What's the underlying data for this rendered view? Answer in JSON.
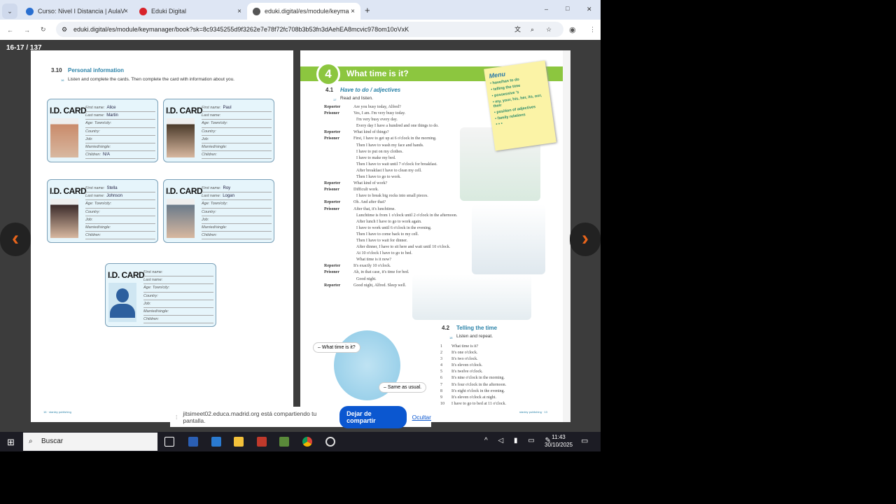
{
  "browser": {
    "tabs": [
      {
        "label": "Curso: Nivel I Distancia | AulaV",
        "close": "×"
      },
      {
        "label": "Eduki Digital",
        "close": "×"
      },
      {
        "label": "eduki.digital/es/module/keyma",
        "close": "×"
      }
    ],
    "new_tab": "+",
    "url": "eduki.digital/es/module/keymanager/book?sk=8c9345255d9f3262e7e78f72fc708b3b53fn3dAehEA8mcvic978om10oVxK",
    "controls": {
      "minimize": "–",
      "maximize": "□",
      "close": "✕"
    }
  },
  "viewer": {
    "page_count": "16-17 / 137",
    "prev": "‹",
    "next": "›"
  },
  "left_page": {
    "section_num": "3.10",
    "section_title": "Personal information",
    "track": "16",
    "instruction": "Listen and complete the cards. Then complete the card with information about you.",
    "card_title": "I.D. CARD",
    "field_labels": [
      "First name:",
      "Last name:",
      "Age:     Town/city:",
      "Country:",
      "Job:",
      "Married/single:",
      "Children:"
    ],
    "cards": [
      {
        "values": [
          "Alice",
          "Martin",
          "",
          "",
          "",
          "",
          "N/A"
        ]
      },
      {
        "values": [
          "Paul",
          "",
          "",
          "",
          "",
          "",
          ""
        ]
      },
      {
        "values": [
          "Stella",
          "Johnson",
          "",
          "",
          "",
          "",
          ""
        ]
      },
      {
        "values": [
          "Roy",
          "Logan",
          "",
          "",
          "",
          "",
          ""
        ]
      },
      {
        "values": [
          "",
          "",
          "",
          "",
          "",
          "",
          ""
        ]
      }
    ],
    "footer": "16 · stanley publishing"
  },
  "right_page": {
    "unit_num": "4",
    "unit_title": "What time is it?",
    "s1_num": "4.1",
    "s1_title": "Have to do / adjectives",
    "s1_track": "17",
    "s1_instr": "Read and listen.",
    "menu": {
      "title": "Menu",
      "items": [
        "• have/has to do",
        "• telling the time",
        "• possessive 's",
        "• my, your, his, her, its, our, their",
        "• position of adjectives",
        "• family relations",
        "* * *"
      ]
    },
    "dialogue": [
      {
        "s": "Reporter",
        "t": "Are you busy today, Alfred?"
      },
      {
        "s": "Prisoner",
        "t": "Yes, I am. I'm very busy today."
      },
      {
        "s": "",
        "t": "I'm very busy every day."
      },
      {
        "s": "",
        "t": "Every day I have a hundred and one things to do."
      },
      {
        "s": "Reporter",
        "t": "What kind of things?"
      },
      {
        "s": "Prisoner",
        "t": "First, I have to get up at 6 o'clock in the morning."
      },
      {
        "s": "",
        "t": "Then I have to wash my face and hands."
      },
      {
        "s": "",
        "t": "I have to put on my clothes."
      },
      {
        "s": "",
        "t": "I have to make my bed."
      },
      {
        "s": "",
        "t": "Then I have to wait until 7 o'clock for breakfast."
      },
      {
        "s": "",
        "t": "After breakfast I have to clean my cell."
      },
      {
        "s": "",
        "t": "Then I have to go to work."
      },
      {
        "s": "Reporter",
        "t": "What kind of work?"
      },
      {
        "s": "Prisoner",
        "t": "Difficult work."
      },
      {
        "s": "",
        "t": "I have to break big rocks into small pieces."
      },
      {
        "s": "Reporter",
        "t": "Oh. And after that?"
      },
      {
        "s": "Prisoner",
        "t": "After that, it's lunchtime."
      },
      {
        "s": "",
        "t": "Lunchtime is from 1 o'clock until 2 o'clock in the afternoon."
      },
      {
        "s": "",
        "t": "After lunch I have to go to work again."
      },
      {
        "s": "",
        "t": "I have to work until 6 o'clock in the evening."
      },
      {
        "s": "",
        "t": "Then I have to come back to my cell."
      },
      {
        "s": "",
        "t": "Then I have to wait for dinner."
      },
      {
        "s": "",
        "t": "After dinner, I have to sit here and wait until 10 o'clock."
      },
      {
        "s": "",
        "t": "At 10 o'clock I have to go to bed."
      },
      {
        "s": "",
        "t": "What time is it now?"
      },
      {
        "s": "Reporter",
        "t": "It's exactly 10 o'clock."
      },
      {
        "s": "Prisoner",
        "t": "Ah, in that case, it's time for bed."
      },
      {
        "s": "",
        "t": "Good night."
      },
      {
        "s": "Reporter",
        "t": "Good night, Alfred. Sleep well."
      }
    ],
    "bubble1": "– What time is it?",
    "bubble2": "– Same as usual.",
    "s2_num": "4.2",
    "s2_title": "Telling the time",
    "s2_track": "18",
    "s2_instr": "Listen and repeat.",
    "times": [
      "What time is it?",
      "It's one o'clock.",
      "It's two o'clock.",
      "It's eleven o'clock.",
      "It's twelve o'clock.",
      "It's nine o'clock in the morning.",
      "It's four o'clock in the afternoon.",
      "It's eight o'clock in the evening.",
      "It's eleven o'clock at night.",
      "I have to go to bed at 11 o'clock."
    ],
    "footer": "stanley publishing · 13"
  },
  "share_bar": {
    "text": "jitsimeet02.educa.madrid.org está compartiendo tu pantalla.",
    "stop": "Dejar de compartir",
    "hide": "Ocultar"
  },
  "taskbar": {
    "search": "Buscar",
    "time": "11:43",
    "date": "30/10/2025"
  }
}
